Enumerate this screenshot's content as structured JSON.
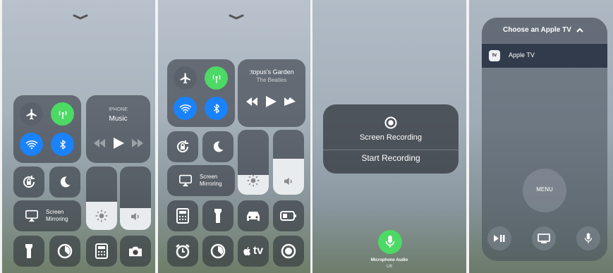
{
  "panel1": {
    "music_header": "IPHONE",
    "music_title": "Music",
    "screen_mirroring_line1": "Screen",
    "screen_mirroring_line2": "Mirroring",
    "brightness_level": 0.45,
    "volume_level": 0.35
  },
  "panel2": {
    "now_playing_title": ":topus's Garden",
    "now_playing_artist": "The Beatles",
    "screen_mirroring_line1": "Screen",
    "screen_mirroring_line2": "Mirroring",
    "brightness_level": 0.3,
    "volume_level": 0.55,
    "appletv_label": "tv"
  },
  "panel3": {
    "title": "Screen Recording",
    "action": "Start Recording",
    "mic_label": "Microphone Audio",
    "mic_state": "Off"
  },
  "panel4": {
    "header": "Choose an Apple TV",
    "device": "Apple TV",
    "device_badge": "tv",
    "menu_label": "MENU"
  },
  "colors": {
    "green": "#4cd964",
    "blue": "#1a82fb",
    "tile": "#2c3038"
  }
}
